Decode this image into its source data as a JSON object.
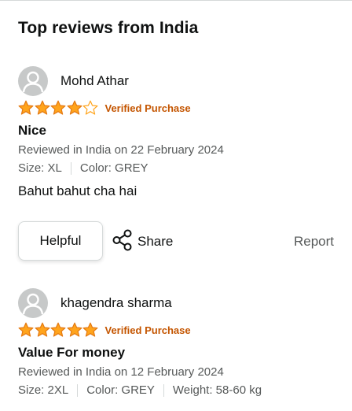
{
  "section_title": "Top reviews from India",
  "reviews": [
    {
      "reviewer": "Mohd Athar",
      "rating": 4,
      "max_rating": 5,
      "verified": "Verified Purchase",
      "title": "Nice",
      "date": "Reviewed in India on 22 February 2024",
      "attributes": [
        "Size: XL",
        "Color: GREY"
      ],
      "body": "Bahut bahut cha hai"
    },
    {
      "reviewer": "khagendra sharma",
      "rating": 5,
      "max_rating": 5,
      "verified": "Verified Purchase",
      "title": "Value For money",
      "date": "Reviewed in India on 12 February 2024",
      "attributes": [
        "Size: 2XL",
        "Color: GREY",
        "Weight: 58-60 kg"
      ]
    }
  ],
  "actions": {
    "helpful_label": "Helpful",
    "share_label": "Share",
    "report_label": "Report"
  },
  "colors": {
    "star": "#ffa41c",
    "verified": "#c45500",
    "muted": "#565959"
  },
  "icons": {
    "avatar": "person-placeholder-icon",
    "share": "share-icon",
    "star": "star-icon"
  }
}
